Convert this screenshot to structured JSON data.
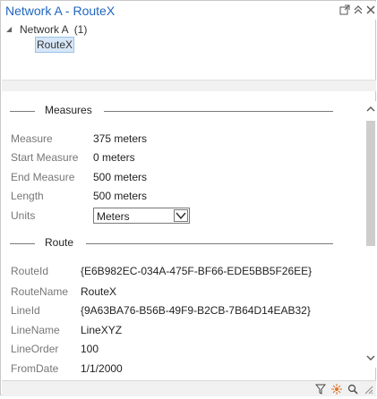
{
  "window": {
    "title": "Network A - RouteX"
  },
  "tree": {
    "network_label": "Network A",
    "network_count": "(1)",
    "route_label": "RouteX"
  },
  "sections": {
    "measures_title": "Measures",
    "route_title": "Route"
  },
  "measures": {
    "measure_label": "Measure",
    "measure_value": "375 meters",
    "start_label": "Start Measure",
    "start_value": "0 meters",
    "end_label": "End Measure",
    "end_value": "500 meters",
    "length_label": "Length",
    "length_value": "500 meters",
    "units_label": "Units",
    "units_value": "Meters"
  },
  "route": {
    "routeid_label": "RouteId",
    "routeid_value": "{E6B982EC-034A-475F-BF66-EDE5BB5F26EE}",
    "routename_label": "RouteName",
    "routename_value": "RouteX",
    "lineid_label": "LineId",
    "lineid_value": "{9A63BA76-B56B-49F9-B2CB-7B64D14EAB32}",
    "linename_label": "LineName",
    "linename_value": "LineXYZ",
    "lineorder_label": "LineOrder",
    "lineorder_value": "100",
    "fromdate_label": "FromDate",
    "fromdate_value": "1/1/2000"
  },
  "colors": {
    "title": "#1f66c1",
    "selection_bg": "#d7e7f7",
    "flash_icon": "#e07020"
  }
}
